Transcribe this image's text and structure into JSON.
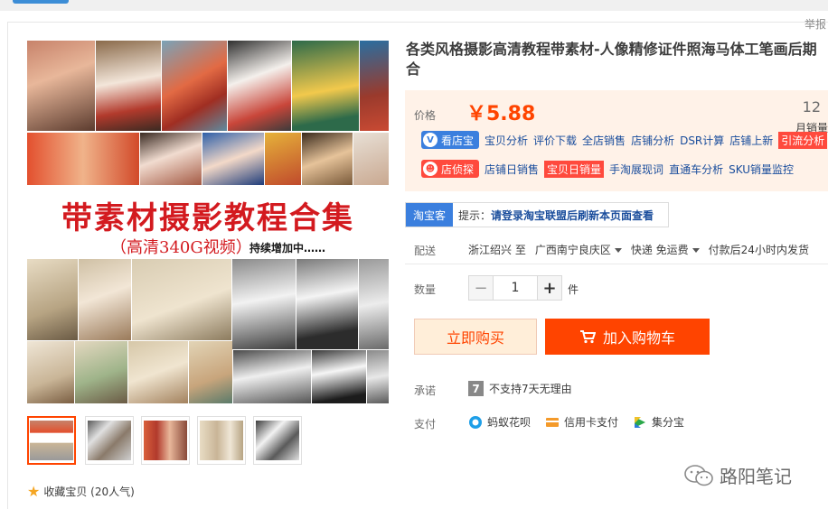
{
  "report": "举报",
  "product": {
    "title": "各类风格摄影高清教程带素材-人像精修证件照海马体工笔画后期合"
  },
  "gallery": {
    "big_title": "带素材摄影教程合集",
    "sub_title": "（高清340G视频）",
    "sub_note": "持续增加中……"
  },
  "favorite": {
    "label": "收藏宝贝 (20人气)"
  },
  "price": {
    "label": "价格",
    "value": "￥5.88",
    "monthly_sales": "12",
    "monthly_sales_label": "月销量"
  },
  "tools": {
    "row1_badge": "看店宝",
    "row1_links": [
      "宝贝分析",
      "评价下载",
      "全店销售",
      "店铺分析",
      "DSR计算",
      "店铺上新",
      "引流分析"
    ],
    "row2_badge": "店侦探",
    "row2_links": [
      "店铺日销售",
      "宝贝日销量",
      "手淘展现词",
      "直通车分析",
      "SKU销量监控"
    ]
  },
  "alliance": {
    "tag": "淘宝客",
    "tip_prefix": "提示：",
    "tip_text": "请登录淘宝联盟后刷新本页面查看"
  },
  "shipping": {
    "label": "配送",
    "from": "浙江绍兴 至",
    "to": "广西南宁良庆区",
    "delivery": "快递 免运费",
    "promise": "付款后24小时内发货"
  },
  "quantity": {
    "label": "数量",
    "minus": "−",
    "value": "1",
    "plus": "+",
    "unit": "件"
  },
  "actions": {
    "buy_now": "立即购买",
    "add_to_cart": "加入购物车"
  },
  "commitment": {
    "label": "承诺",
    "icon_text": "7",
    "text": "不支持7天无理由"
  },
  "payment": {
    "label": "支付",
    "methods": [
      "蚂蚁花呗",
      "信用卡支付",
      "集分宝"
    ]
  },
  "watermark": "路阳笔记",
  "colors": {
    "accent": "#ff4400",
    "link": "#1a4d9c",
    "badge_blue": "#3b7fde",
    "badge_red": "#ff4a3d",
    "price_bg": "#fff2e8"
  }
}
